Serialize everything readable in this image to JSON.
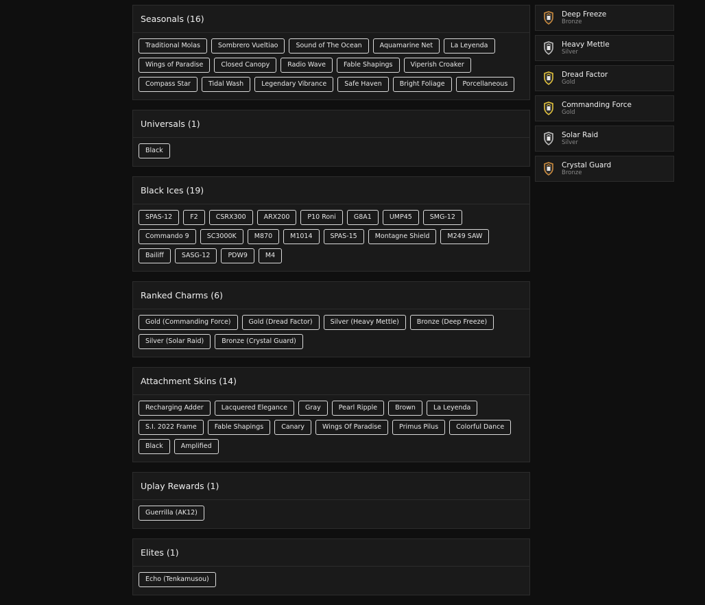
{
  "sections": [
    {
      "title": "Seasonals (16)",
      "tags": [
        "Traditional Molas",
        "Sombrero Vueltiao",
        "Sound of The Ocean",
        "Aquamarine Net",
        "La Leyenda",
        "Wings of Paradise",
        "Closed Canopy",
        "Radio Wave",
        "Fable Shapings",
        "Viperish Croaker",
        "Compass Star",
        "Tidal Wash",
        "Legendary Vibrance",
        "Safe Haven",
        "Bright Foliage",
        "Porcellaneous"
      ]
    },
    {
      "title": "Universals (1)",
      "tags": [
        "Black"
      ]
    },
    {
      "title": "Black Ices (19)",
      "tags": [
        "SPAS-12",
        "F2",
        "CSRX300",
        "ARX200",
        "P10 Roni",
        "G8A1",
        "UMP45",
        "SMG-12",
        "Commando 9",
        "SC3000K",
        "M870",
        "M1014",
        "SPAS-15",
        "Montagne Shield",
        "M249 SAW",
        "Bailiff",
        "SASG-12",
        "PDW9",
        "M4"
      ]
    },
    {
      "title": "Ranked Charms (6)",
      "tags": [
        "Gold (Commanding Force)",
        "Gold (Dread Factor)",
        "Silver (Heavy Mettle)",
        "Bronze (Deep Freeze)",
        "Silver (Solar Raid)",
        "Bronze (Crystal Guard)"
      ]
    },
    {
      "title": "Attachment Skins (14)",
      "tags": [
        "Recharging Adder",
        "Lacquered Elegance",
        "Gray",
        "Pearl Ripple",
        "Brown",
        "La Leyenda",
        "S.I. 2022 Frame",
        "Fable Shapings",
        "Canary",
        "Wings Of Paradise",
        "Primus Pilus",
        "Colorful Dance",
        "Black",
        "Amplified"
      ]
    },
    {
      "title": "Uplay Rewards (1)",
      "tags": [
        "Guerrilla (AK12)"
      ]
    },
    {
      "title": "Elites (1)",
      "tags": [
        "Echo (Tenkamusou)"
      ]
    }
  ],
  "ranks": [
    {
      "name": "Deep Freeze",
      "tier": "Bronze",
      "color": "#c98a3e"
    },
    {
      "name": "Heavy Mettle",
      "tier": "Silver",
      "color": "#bdbdbd"
    },
    {
      "name": "Dread Factor",
      "tier": "Gold",
      "color": "#e2c23c"
    },
    {
      "name": "Commanding Force",
      "tier": "Gold",
      "color": "#e2c23c"
    },
    {
      "name": "Solar Raid",
      "tier": "Silver",
      "color": "#bdbdbd"
    },
    {
      "name": "Crystal Guard",
      "tier": "Bronze",
      "color": "#c98a3e"
    }
  ],
  "icons": {
    "rank": "rank-badge-icon"
  }
}
